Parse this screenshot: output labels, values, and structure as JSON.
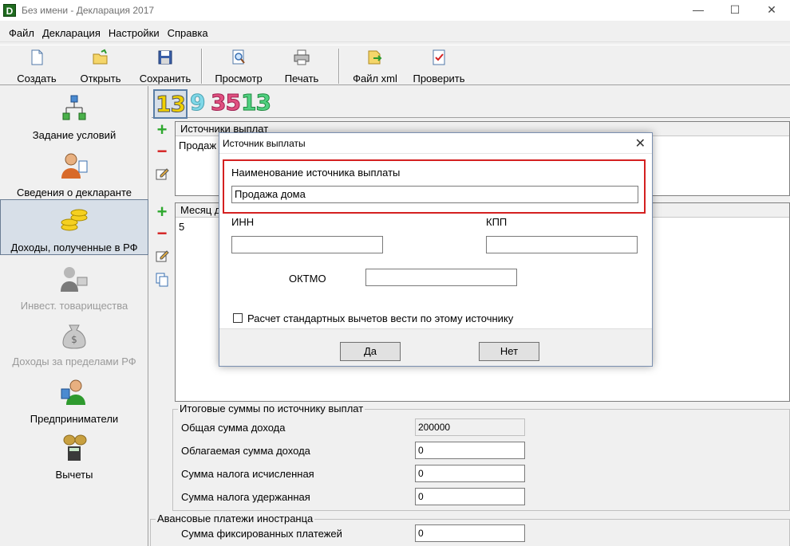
{
  "window": {
    "title": "Без имени - Декларация 2017",
    "app_icon_letter": "D",
    "minimize": "—",
    "maximize": "☐",
    "close": "✕"
  },
  "menu": {
    "items": [
      "Файл",
      "Декларация",
      "Настройки",
      "Справка"
    ]
  },
  "toolbar": {
    "create": "Создать",
    "open": "Открыть",
    "save": "Сохранить",
    "preview": "Просмотр",
    "print": "Печать",
    "xml": "Файл xml",
    "check": "Проверить"
  },
  "sidebar": {
    "items": [
      {
        "label": "Задание условий",
        "enabled": true
      },
      {
        "label": "Сведения о декларанте",
        "enabled": true
      },
      {
        "label": "Доходы, полученные в РФ",
        "enabled": true,
        "active": true
      },
      {
        "label": "Инвест. товарищества",
        "enabled": false
      },
      {
        "label": "Доходы за пределами РФ",
        "enabled": false
      },
      {
        "label": "Предприниматели",
        "enabled": true
      },
      {
        "label": "Вычеты",
        "enabled": true
      }
    ]
  },
  "rates": {
    "r13a": "13",
    "r9": "9",
    "r35": "35",
    "r13b": "13"
  },
  "sources_panel": {
    "header": "Источники выплат",
    "row1": "Продаж"
  },
  "months_panel": {
    "header": "Месяц д",
    "row1": "5"
  },
  "totals": {
    "title": "Итоговые суммы по источнику выплат",
    "total_income_label": "Общая сумма дохода",
    "total_income": "200000",
    "taxable_income_label": "Облагаемая сумма дохода",
    "taxable_income": "0",
    "tax_calc_label": "Сумма налога исчисленная",
    "tax_calc": "0",
    "tax_withheld_label": "Сумма налога удержанная",
    "tax_withheld": "0"
  },
  "advance": {
    "title": "Авансовые платежи иностранца",
    "fixed_label": "Сумма фиксированных платежей",
    "fixed_value": "0"
  },
  "dialog": {
    "title": "Источник выплаты",
    "close": "✕",
    "name_label": "Наименование источника выплаты",
    "name_value": "Продажа дома",
    "inn_label": "ИНН",
    "inn_value": "",
    "kpp_label": "КПП",
    "kpp_value": "",
    "oktmo_label": "ОКТМО",
    "oktmo_value": "",
    "std_deductions_label": "Расчет стандартных вычетов вести по этому источнику",
    "std_deductions_checked": false,
    "ok": "Да",
    "cancel": "Нет"
  }
}
